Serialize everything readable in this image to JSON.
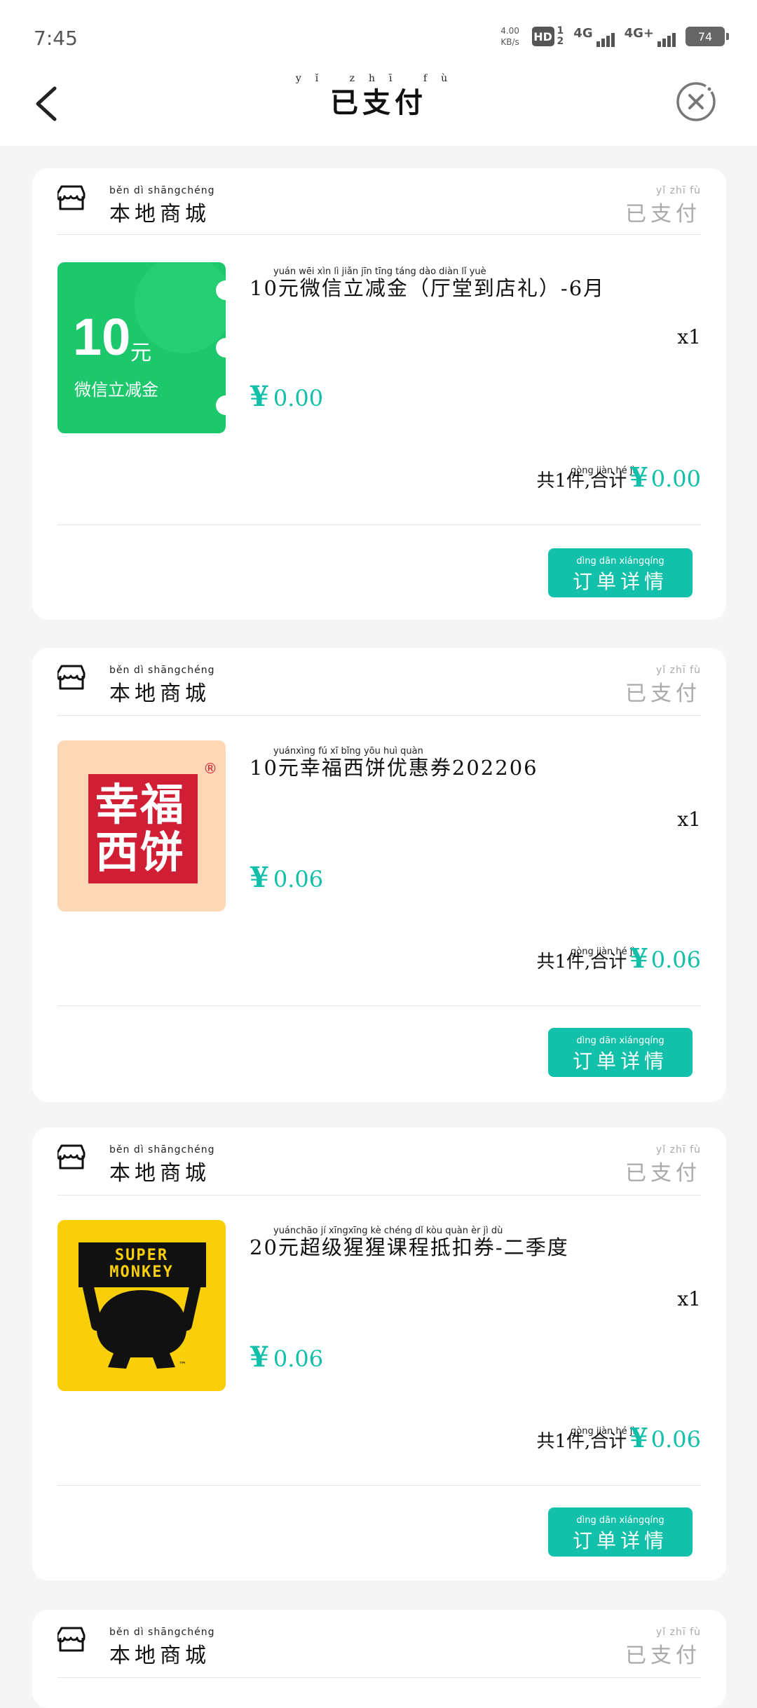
{
  "status_bar": {
    "time": "7:45",
    "net_speed_value": "4.00",
    "net_speed_unit": "KB/s",
    "hd": "HD",
    "sim1": "1",
    "sim2": "2",
    "signal1_label": "4G",
    "signal2_label": "4G+",
    "battery": "74"
  },
  "header": {
    "title": "已支付",
    "title_ruby": "yǐ zhī fù",
    "back_icon": "chevron-left-icon",
    "close_icon": "close-circle-icon"
  },
  "orders": [
    {
      "shop_ruby": "běn  dì  shāngchéng",
      "shop_name": "本地商城",
      "status_ruby": "yǐ  zhī  fù",
      "status": "已支付",
      "product_ruby": "yuán wēi  xìn   lì   jiǎn  jīn            tīng táng dào diàn   lǐ                      yuè",
      "product_name": "10元微信立减金（厅堂到店礼）-6月",
      "thumb_big": "10",
      "thumb_unit": "元",
      "thumb_caption": "微信立减金",
      "qty": "x1",
      "price_symbol": "¥",
      "price": "0.00",
      "total_ruby": "gòng    jiàn   hé    jì",
      "total_prefix": "共1件,合计",
      "total_symbol": "¥",
      "total": "0.00",
      "button_ruby": "dìng dān xiángqíng",
      "button_label": "订单详情"
    },
    {
      "shop_ruby": "běn  dì  shāngchéng",
      "shop_name": "本地商城",
      "status_ruby": "yǐ  zhī  fù",
      "status": "已支付",
      "product_ruby": "yuánxìng  fú   xī  bǐng yōu  huì quàn",
      "product_name": "10元幸福西饼优惠券202206",
      "thumb_big": "幸福西饼",
      "thumb_unit": "®",
      "thumb_caption": "",
      "qty": "x1",
      "price_symbol": "¥",
      "price": "0.06",
      "total_ruby": "gòng    jiàn   hé    jì",
      "total_prefix": "共1件,合计",
      "total_symbol": "¥",
      "total": "0.06",
      "button_ruby": "dìng dān xiángqíng",
      "button_label": "订单详情"
    },
    {
      "shop_ruby": "běn  dì  shāngchéng",
      "shop_name": "本地商城",
      "status_ruby": "yǐ  zhī  fù",
      "status": "已支付",
      "product_ruby": "yuánchāo  jí  xīngxīng kè chéng dǐ  kòu quàn   èr    jì    dù",
      "product_name": "20元超级猩猩课程抵扣券-二季度",
      "thumb_big": "SUPER",
      "thumb_unit": "MONKEY",
      "thumb_caption": "™",
      "qty": "x1",
      "price_symbol": "¥",
      "price": "0.06",
      "total_ruby": "gòng    jiàn   hé    jì",
      "total_prefix": "共1件,合计",
      "total_symbol": "¥",
      "total": "0.06",
      "button_ruby": "dìng dān xiángqíng",
      "button_label": "订单详情"
    },
    {
      "shop_ruby": "běn  dì  shāngchéng",
      "shop_name": "本地商城",
      "status_ruby": "yǐ  zhī  fù",
      "status": "已支付"
    }
  ],
  "colors": {
    "accent": "#13c0aa",
    "wechat_green": "#1dc76b",
    "xingfu_red": "#d01f35",
    "xingfu_bg": "#fdd8b6",
    "monkey_yellow": "#f9cf0a"
  }
}
